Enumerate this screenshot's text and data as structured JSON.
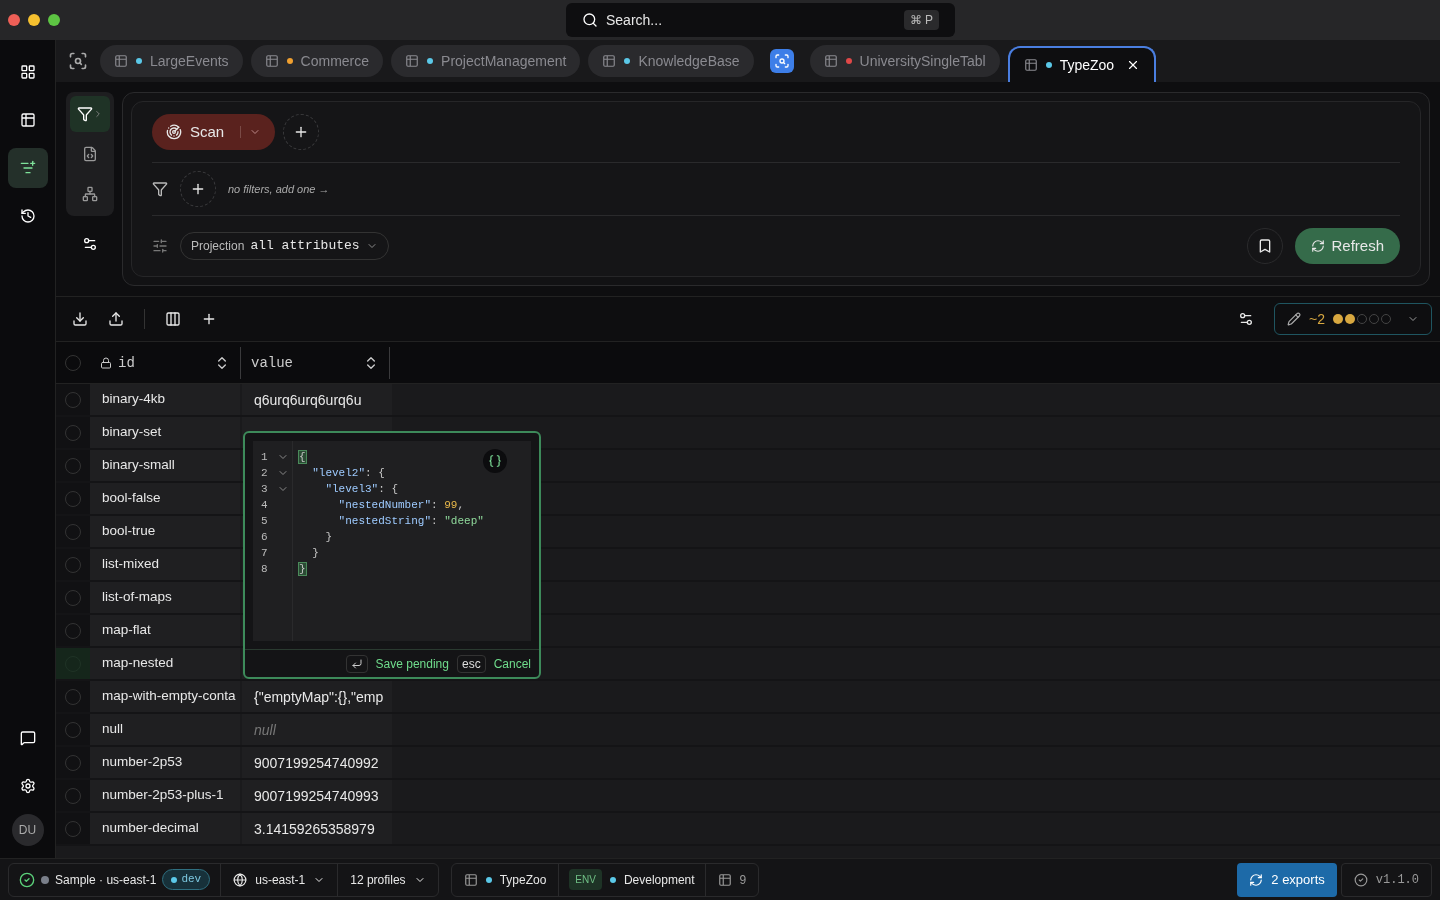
{
  "search": {
    "placeholder": "Search...",
    "shortcut": "⌘ P"
  },
  "rail": {
    "items": [
      {
        "kind": "grid",
        "selected": false
      },
      {
        "kind": "table",
        "selected": false
      },
      {
        "kind": "filter",
        "selected": true
      },
      {
        "kind": "history",
        "selected": false
      }
    ],
    "bottom": [
      {
        "kind": "chat"
      },
      {
        "kind": "settings"
      }
    ],
    "avatar": "DU"
  },
  "tabs": [
    {
      "kind": "table",
      "label": "LargeEvents",
      "color": "#5bc8e8",
      "selected": false
    },
    {
      "kind": "table",
      "label": "Commerce",
      "color": "#f0a030",
      "selected": false
    },
    {
      "kind": "table",
      "label": "ProjectManagement",
      "color": "#5bc8e8",
      "selected": false
    },
    {
      "kind": "table",
      "label": "KnowledgeBase",
      "color": "#5bc8e8",
      "selected": false
    },
    {
      "kind": "icon",
      "selected": false
    },
    {
      "kind": "table",
      "label": "UniversitySingleTabl",
      "color": "#e04848",
      "selected": false
    },
    {
      "kind": "table",
      "label": "TypeZoo",
      "color": "#5bc8e8",
      "selected": true
    }
  ],
  "query": {
    "tools": [
      {
        "kind": "filter",
        "selected": true
      },
      {
        "kind": "code",
        "selected": false
      },
      {
        "kind": "tree",
        "selected": false
      }
    ],
    "operation": "Scan",
    "filters_hint": "no filters, add one →",
    "projection_label": "Projection",
    "projection_value": "all attributes",
    "refresh": "Refresh"
  },
  "toolbar": {
    "pending": "~2",
    "stars": 2
  },
  "table": {
    "select_all": {
      "checked": false
    },
    "columns": [
      {
        "label": "id",
        "locked": true
      },
      {
        "label": "value",
        "locked": false
      }
    ],
    "rows": [
      {
        "id": "binary-4kb",
        "value": "q6urq6urq6urq6u",
        "kind": "text",
        "selected": false
      },
      {
        "id": "binary-set",
        "selected": false
      },
      {
        "id": "binary-small",
        "selected": false
      },
      {
        "id": "bool-false",
        "selected": false
      },
      {
        "id": "bool-true",
        "selected": false
      },
      {
        "id": "list-mixed",
        "selected": false
      },
      {
        "id": "list-of-maps",
        "selected": false
      },
      {
        "id": "map-flat",
        "selected": false
      },
      {
        "id": "map-nested",
        "selected": true
      },
      {
        "id": "map-with-empty-conta",
        "value": "{\"emptyMap\":{},\"emp",
        "kind": "text",
        "selected": false
      },
      {
        "id": "null",
        "value": "null",
        "kind": "null",
        "selected": false
      },
      {
        "id": "number-2p53",
        "value": "9007199254740992",
        "kind": "text",
        "selected": false
      },
      {
        "id": "number-2p53-plus-1",
        "value": "9007199254740993",
        "kind": "text",
        "selected": false
      },
      {
        "id": "number-decimal",
        "value": "3.14159265358979",
        "kind": "text",
        "selected": false
      }
    ]
  },
  "editor": {
    "lines": [
      {
        "n": "1",
        "fold": true,
        "parts": [
          {
            "kind": "bracket",
            "text": "{"
          }
        ]
      },
      {
        "n": "2",
        "fold": true,
        "parts": [
          {
            "kind": "key",
            "text": "  \"level2\""
          },
          {
            "kind": "punct",
            "text": ": {"
          }
        ]
      },
      {
        "n": "3",
        "fold": true,
        "parts": [
          {
            "kind": "key",
            "text": "    \"level3\""
          },
          {
            "kind": "punct",
            "text": ": {"
          }
        ]
      },
      {
        "n": "4",
        "fold": false,
        "parts": [
          {
            "kind": "key",
            "text": "      \"nestedNumber\""
          },
          {
            "kind": "punct",
            "text": ": "
          },
          {
            "kind": "number",
            "text": "99"
          },
          {
            "kind": "punct",
            "text": ","
          }
        ]
      },
      {
        "n": "5",
        "fold": false,
        "parts": [
          {
            "kind": "key",
            "text": "      \"nestedString\""
          },
          {
            "kind": "punct",
            "text": ": "
          },
          {
            "kind": "string",
            "text": "\"deep\""
          }
        ]
      },
      {
        "n": "6",
        "fold": false,
        "parts": [
          {
            "kind": "punct",
            "text": "    }"
          }
        ]
      },
      {
        "n": "7",
        "fold": false,
        "parts": [
          {
            "kind": "punct",
            "text": "  }"
          }
        ]
      },
      {
        "n": "8",
        "fold": false,
        "parts": [
          {
            "kind": "bracket",
            "text": "}"
          }
        ]
      }
    ],
    "save": "Save pending",
    "esc_key": "esc",
    "cancel": "Cancel"
  },
  "status": {
    "connection": "Sample",
    "separator": "·",
    "region": "us-east-1",
    "env_badge": "dev",
    "region_select": "us-east-1",
    "profiles": "12 profiles",
    "table": "TypeZoo",
    "env_tag": "ENV",
    "environment": "Development",
    "count": "9",
    "exports": "2 exports",
    "version": "v1.1.0"
  }
}
